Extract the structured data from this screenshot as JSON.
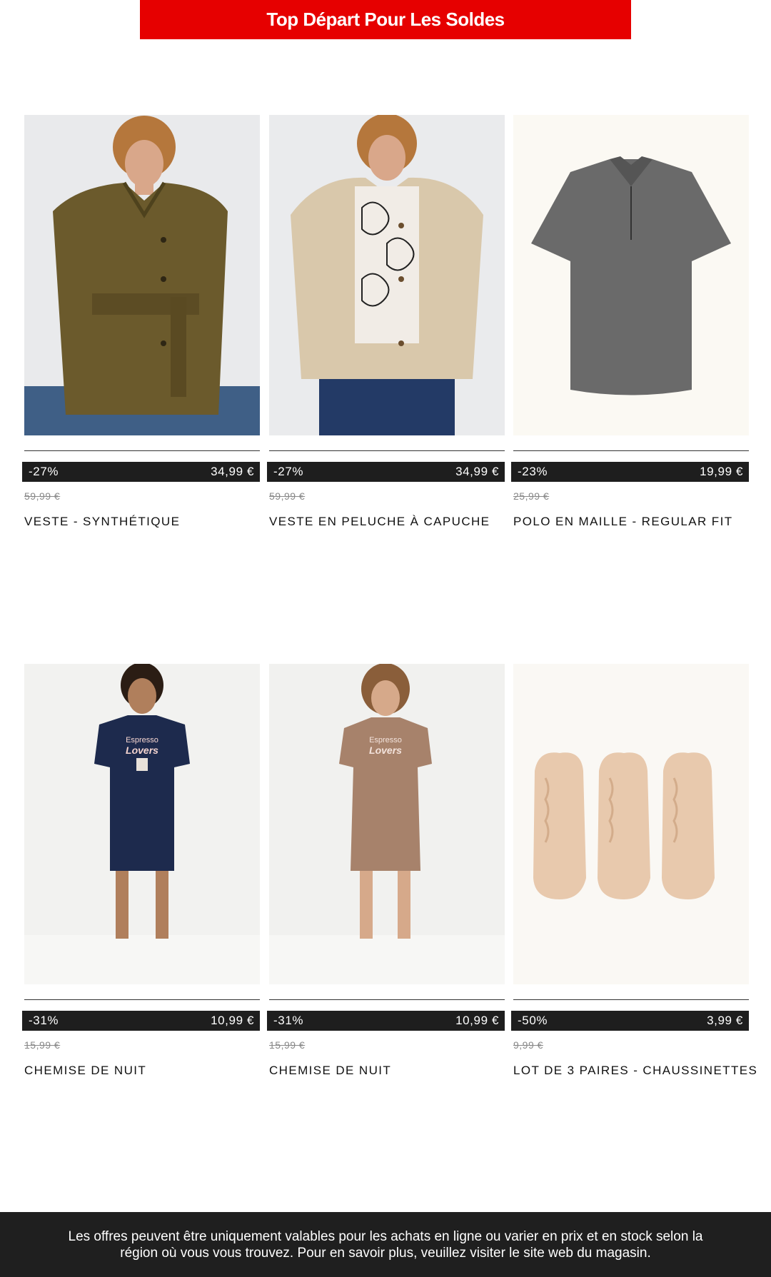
{
  "banner": {
    "title": "Top Départ Pour Les Soldes"
  },
  "products": [
    {
      "discount": "-27%",
      "price": "34,99 €",
      "old_price": "59,99 €",
      "name": "VESTE - SYNTHÉTIQUE",
      "image": "olive-belted-jacket"
    },
    {
      "discount": "-27%",
      "price": "34,99 €",
      "old_price": "59,99 €",
      "name": "VESTE EN PELUCHE À CAPUCHE",
      "image": "beige-teddy-jacket"
    },
    {
      "discount": "-23%",
      "price": "19,99 €",
      "old_price": "25,99 €",
      "name": "POLO EN MAILLE - REGULAR FIT",
      "image": "grey-knit-polo"
    },
    {
      "discount": "-31%",
      "price": "10,99 €",
      "old_price": "15,99 €",
      "name": "CHEMISE DE NUIT",
      "image": "navy-nightshirt",
      "print_line1": "Espresso",
      "print_line2": "Lovers"
    },
    {
      "discount": "-31%",
      "price": "10,99 €",
      "old_price": "15,99 €",
      "name": "CHEMISE DE NUIT",
      "image": "taupe-nightshirt",
      "print_line1": "Espresso",
      "print_line2": "Lovers"
    },
    {
      "discount": "-50%",
      "price": "3,99 €",
      "old_price": "9,99 €",
      "name": "LOT DE 3 PAIRES - CHAUSSINETTES",
      "image": "nude-sock-liners"
    }
  ],
  "footer": {
    "text": "Les offres peuvent être uniquement valables pour les achats en ligne ou varier en prix et en stock selon la région où vous vous trouvez. Pour en savoir plus, veuillez visiter le site web du magasin."
  },
  "colors": {
    "banner_bg": "#e60000",
    "pricebar_bg": "#1e1e1e",
    "footer_bg": "#1f1f1f"
  }
}
